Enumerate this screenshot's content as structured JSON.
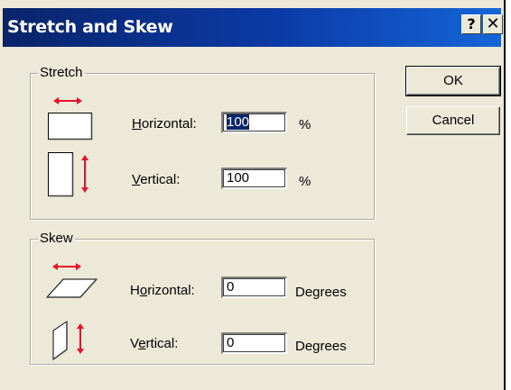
{
  "window": {
    "title": "Stretch and Skew",
    "help_glyph": "?",
    "close_glyph": "✕"
  },
  "buttons": {
    "ok": "OK",
    "cancel": "Cancel"
  },
  "stretch": {
    "legend": "Stretch",
    "horizontal": {
      "label_mnemonic": "H",
      "label_rest": "orizontal:",
      "value": "100",
      "unit": "%",
      "icon": "stretch-horizontal-icon"
    },
    "vertical": {
      "label_mnemonic": "V",
      "label_rest": "ertical:",
      "value": "100",
      "unit": "%",
      "icon": "stretch-vertical-icon"
    }
  },
  "skew": {
    "legend": "Skew",
    "horizontal": {
      "label_prefix": "H",
      "label_mnemonic": "o",
      "label_rest": "rizontal:",
      "value": "0",
      "unit": "Degrees",
      "icon": "skew-horizontal-icon"
    },
    "vertical": {
      "label_prefix": "V",
      "label_mnemonic": "e",
      "label_rest": "rtical:",
      "value": "0",
      "unit": "Degrees",
      "icon": "skew-vertical-icon"
    }
  },
  "colors": {
    "title_bar": "#0a246a",
    "arrow_red": "#e8102a",
    "dialog_face": "#ece9d8"
  }
}
